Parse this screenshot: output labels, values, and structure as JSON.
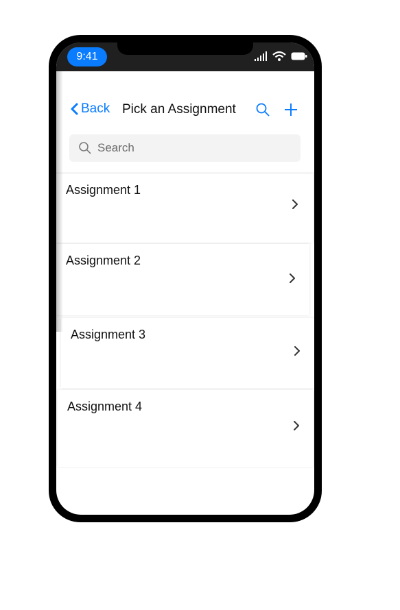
{
  "status_bar": {
    "time": "9:41"
  },
  "nav": {
    "back_label": "Back",
    "title": "Pick an Assignment",
    "search_placeholder": "Search"
  },
  "assignments": [
    {
      "label": "Assignment 1"
    },
    {
      "label": "Assignment 2"
    },
    {
      "label": "Assignment 3"
    },
    {
      "label": "Assignment 4"
    }
  ],
  "colors": {
    "accent": "#0a7cff",
    "status_bar": "#202020"
  }
}
